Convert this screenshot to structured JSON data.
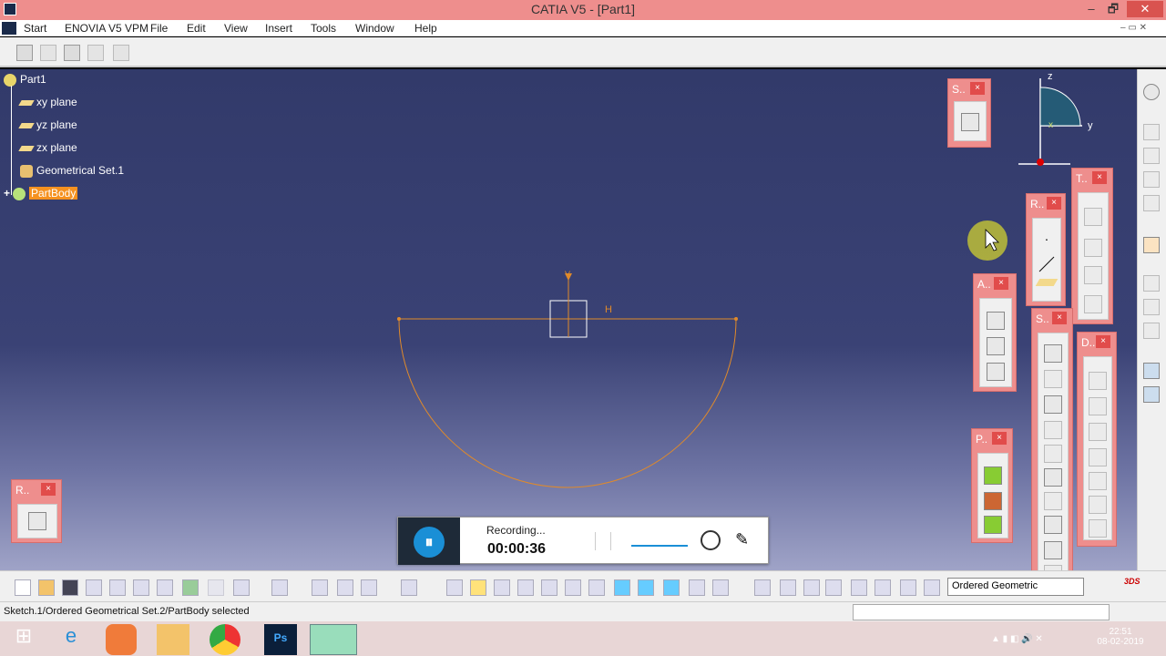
{
  "window": {
    "title": "CATIA V5 - [Part1]",
    "min": "–",
    "restore": "🗗",
    "close": "✕"
  },
  "menu": [
    "Start",
    "ENOVIA V5 VPM",
    "File",
    "Edit",
    "View",
    "Insert",
    "Tools",
    "Window",
    "Help"
  ],
  "tree": {
    "root": "Part1",
    "items": [
      "xy plane",
      "yz plane",
      "zx plane",
      "Geometrical Set.1",
      "PartBody"
    ]
  },
  "compass": {
    "z": "z",
    "y": "y",
    "x": "x"
  },
  "sketch": {
    "v_label": "V",
    "h_label": "H"
  },
  "panels": {
    "s1": "S..",
    "r1": "R..",
    "t1": "T..",
    "a1": "A..",
    "s2": "S..",
    "d1": "D..",
    "p1": "P..",
    "r2": "R..",
    "close": "×"
  },
  "recorder": {
    "status": "Recording...",
    "time": "00:00:36",
    "pause": "⏸"
  },
  "combo": {
    "value": "Ordered Geometric"
  },
  "status": {
    "text": "Sketch.1/Ordered Geometrical Set.2/PartBody selected"
  },
  "taskbar": {
    "time": "22:51",
    "date": "08-02-2019"
  },
  "colors": {
    "titlebar": "#ee8e8d",
    "sketch": "#e08a2a",
    "selection": "#f5911f"
  }
}
